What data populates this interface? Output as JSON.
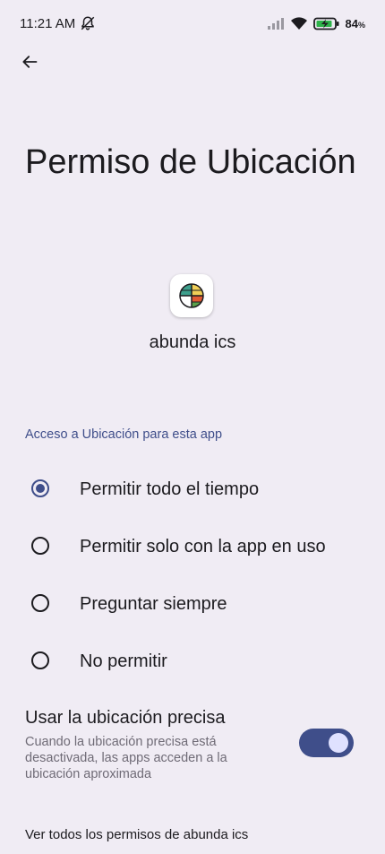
{
  "status_bar": {
    "time": "11:21 AM",
    "battery_percent": "84",
    "battery_unit": "%",
    "icons": [
      "notifications-off-icon",
      "signal-icon",
      "wifi-icon",
      "battery-charging-icon"
    ]
  },
  "header": {
    "title": "Permiso de Ubicación"
  },
  "app": {
    "name": "abunda ics",
    "icon": "app-logo-icon"
  },
  "location_access": {
    "section_label": "Acceso a Ubicación para esta app",
    "options": [
      {
        "label": "Permitir todo el tiempo",
        "selected": true
      },
      {
        "label": "Permitir solo con la app en uso",
        "selected": false
      },
      {
        "label": "Preguntar siempre",
        "selected": false
      },
      {
        "label": "No permitir",
        "selected": false
      }
    ]
  },
  "precise_location": {
    "title": "Usar la ubicación precisa",
    "description": "Cuando la ubicación precisa está desactivada, las apps acceden a la ubicación aproximada",
    "enabled": true
  },
  "footer": {
    "link": "Ver todos los permisos de abunda ics"
  },
  "colors": {
    "background": "#f0ecf4",
    "accent": "#3f4e8a",
    "toggle_thumb": "#dfe1ff",
    "text_primary": "#1c1b1f",
    "text_secondary": "#6f6b76"
  }
}
